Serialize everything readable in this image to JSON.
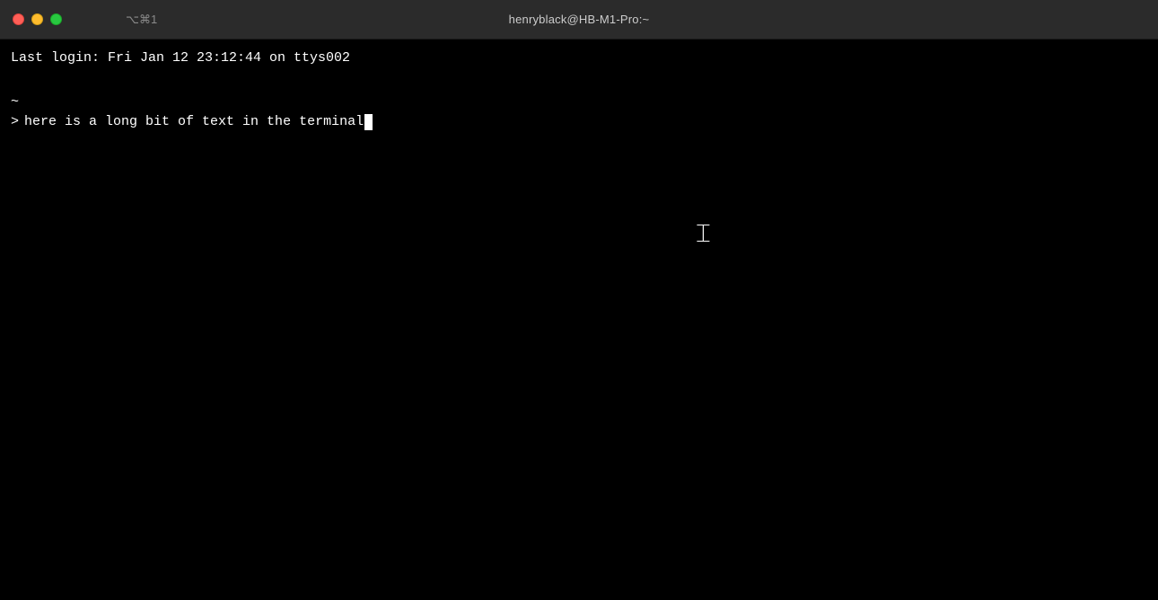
{
  "titlebar": {
    "title": "henryblack@HB-M1-Pro:~",
    "shortcut": "⌥⌘1",
    "close_label": "close",
    "minimize_label": "minimize",
    "maximize_label": "maximize"
  },
  "terminal": {
    "login_line": "Last login: Fri Jan 12 23:12:44 on ttys002",
    "tilde_line": "~",
    "prompt_symbol": ">",
    "command": "here is a long bit of text in the terminal"
  }
}
